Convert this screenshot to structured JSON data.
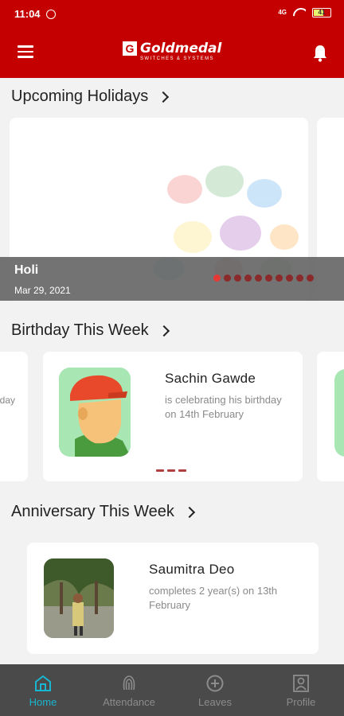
{
  "status_bar": {
    "time": "11:04",
    "signal_text": "4G",
    "battery": "41"
  },
  "app": {
    "brand_name": "Goldmedal",
    "brand_tagline": "SWITCHES & SYSTEMS",
    "brand_mark": "G"
  },
  "holidays": {
    "title": "Upcoming Holidays",
    "current": {
      "name": "Holi",
      "date": "Mar 29, 2021"
    },
    "dot_count": 10,
    "active_dot": 0
  },
  "birthdays": {
    "title": "Birthday This Week",
    "peek_left_text": "day",
    "card": {
      "name": "Sachin  Gawde",
      "line1": "is celebrating his birthday",
      "line2": "on 14th February"
    }
  },
  "anniversaries": {
    "title": "Anniversary This Week",
    "card": {
      "name": "Saumitra  Deo",
      "line1": "completes 2 year(s) on 13th",
      "line2": "February"
    }
  },
  "bottom_nav": [
    {
      "label": "Home",
      "icon": "home-icon",
      "active": true
    },
    {
      "label": "Attendance",
      "icon": "fingerprint-icon",
      "active": false
    },
    {
      "label": "Leaves",
      "icon": "plus-circle-icon",
      "active": false
    },
    {
      "label": "Profile",
      "icon": "profile-icon",
      "active": false
    }
  ],
  "colors": {
    "brand_red": "#c40000",
    "nav_active": "#19b6d1",
    "nav_bg": "#4a4a4a"
  }
}
